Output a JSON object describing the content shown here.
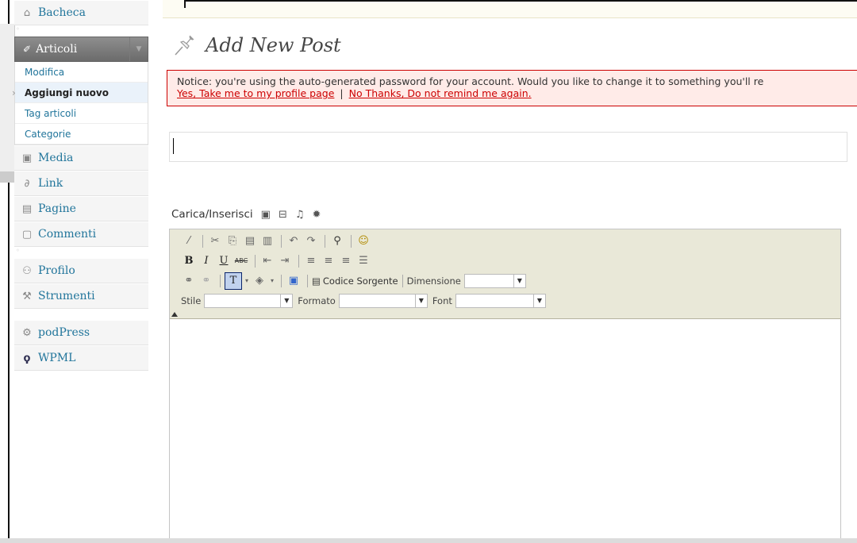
{
  "sidebar": {
    "items_top": [
      {
        "label": "Bacheca",
        "icon": "home-icon"
      }
    ],
    "active": {
      "label": "Articoli",
      "icon": "pin-icon"
    },
    "submenu": [
      "Modifica",
      "Aggiungi nuovo",
      "Tag articoli",
      "Categorie"
    ],
    "items_mid": [
      {
        "label": "Media",
        "icon": "media-icon"
      },
      {
        "label": "Link",
        "icon": "link-icon"
      },
      {
        "label": "Pagine",
        "icon": "pages-icon"
      },
      {
        "label": "Commenti",
        "icon": "comments-icon"
      }
    ],
    "items_bottom": [
      {
        "label": "Profilo",
        "icon": "users-icon"
      },
      {
        "label": "Strumenti",
        "icon": "tools-icon"
      }
    ],
    "items_plugins": [
      {
        "label": "podPress",
        "icon": "gear-icon"
      },
      {
        "label": "WPML",
        "icon": "wpml-icon"
      }
    ]
  },
  "main": {
    "title": "Add New Post",
    "notice": {
      "text": "Notice: you're using the auto-generated password for your account. Would you like to change it to something you'll re",
      "link_yes": "Yes, Take me to my profile page",
      "divider": "|",
      "link_no": "No Thanks, Do not remind me again."
    },
    "title_field": {
      "value": "",
      "placeholder": ""
    },
    "upload_label": "Carica/Inserisci"
  },
  "toolbar": {
    "row2": {
      "bold": "B",
      "italic": "I",
      "underline": "U",
      "strike": "ABC"
    },
    "row3": {
      "source": "Codice Sorgente",
      "size_label": "Dimensione"
    },
    "row4": {
      "style_label": "Stile",
      "format_label": "Formato",
      "font_label": "Font"
    }
  },
  "colors": {
    "accent": "#21759b",
    "notice_bg": "#ffebe8",
    "notice_border": "#cc0000",
    "toolbar_bg": "#e9e8d8"
  }
}
